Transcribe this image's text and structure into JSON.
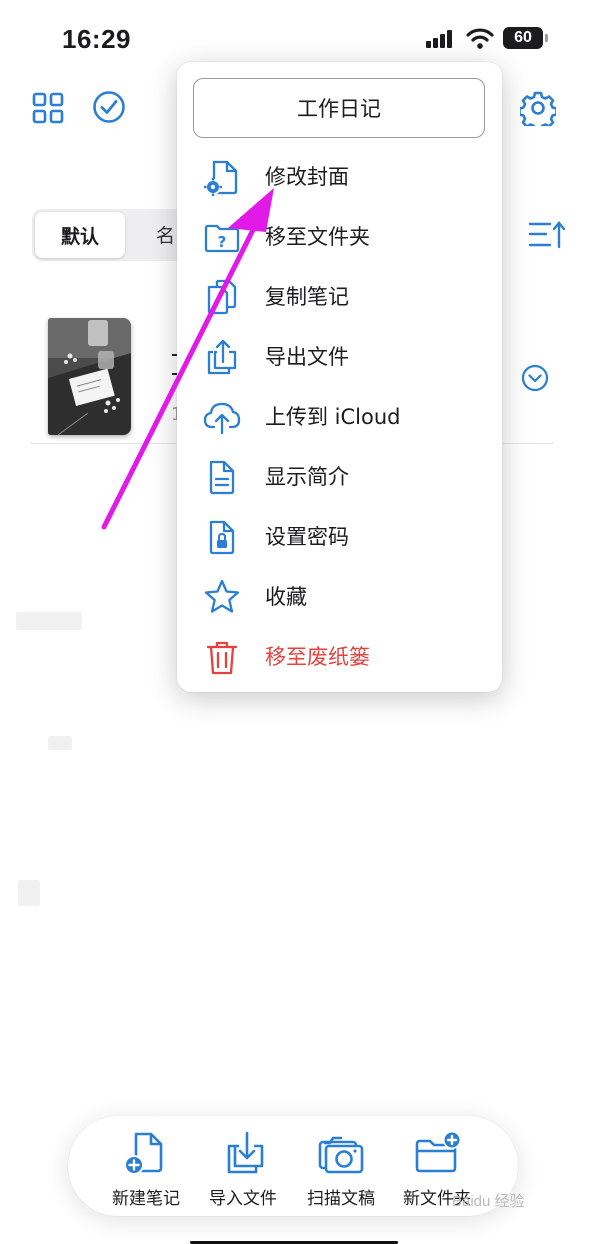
{
  "status_bar": {
    "time": "16:29",
    "battery": "60"
  },
  "toolbar": {
    "grid_icon": "grid-icon",
    "select_icon": "checkmark-circle-icon",
    "settings_icon": "gear-icon"
  },
  "sort": {
    "default_label": "默认",
    "name_label_partial": "名"
  },
  "notebook_row": {
    "meta_partial": "1"
  },
  "menu": {
    "notebook_name": "工作日记",
    "items": [
      {
        "label": "修改封面",
        "icon": "cover-settings-icon"
      },
      {
        "label": "移至文件夹",
        "icon": "folder-question-icon"
      },
      {
        "label": "复制笔记",
        "icon": "copy-icon"
      },
      {
        "label": "导出文件",
        "icon": "export-icon"
      },
      {
        "label": "上传到 iCloud",
        "icon": "icloud-upload-icon"
      },
      {
        "label": "显示简介",
        "icon": "info-document-icon"
      },
      {
        "label": "设置密码",
        "icon": "lock-document-icon"
      },
      {
        "label": "收藏",
        "icon": "star-icon"
      },
      {
        "label": "移至废纸篓",
        "icon": "trash-icon"
      }
    ]
  },
  "bottom_bar": {
    "items": [
      {
        "label": "新建笔记",
        "icon": "new-note-icon"
      },
      {
        "label": "导入文件",
        "icon": "import-icon"
      },
      {
        "label": "扫描文稿",
        "icon": "camera-icon"
      },
      {
        "label": "新文件夹",
        "icon": "new-folder-icon"
      }
    ]
  },
  "colors": {
    "accent": "#2a7fd4",
    "danger": "#e5423e",
    "annotation": "#e21ae8"
  },
  "watermark": "Baidu 经验"
}
